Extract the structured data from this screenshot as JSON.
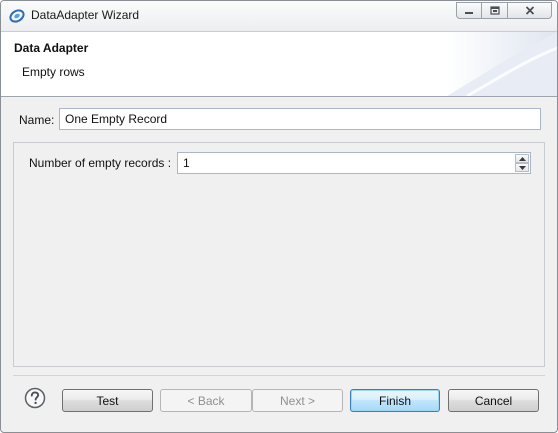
{
  "window": {
    "title": "DataAdapter Wizard",
    "icons": {
      "app": "eclipse-app-icon",
      "minimize": "minimize-icon",
      "maximize": "maximize-icon",
      "close": "close-icon"
    }
  },
  "header": {
    "title": "Data Adapter",
    "description": "Empty rows"
  },
  "form": {
    "name_label": "Name:",
    "name_value": "One Empty Record",
    "empty_records_label": "Number of empty records :",
    "empty_records_value": "1"
  },
  "buttons": {
    "help_icon": "help-question-icon",
    "test": "Test",
    "back": "< Back",
    "next": "Next >",
    "finish": "Finish",
    "cancel": "Cancel"
  },
  "colors": {
    "default_button_border": "#3c7fb1",
    "header_bg": "#ffffff",
    "dialog_bg": "#f0f0f0"
  }
}
